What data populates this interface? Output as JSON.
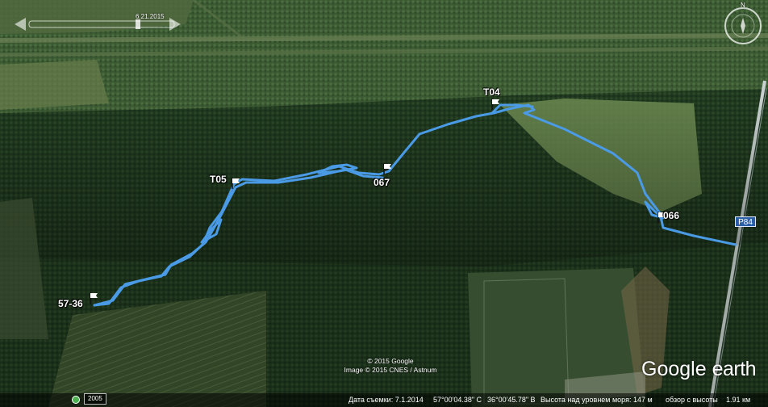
{
  "time_slider": {
    "date": "6.21.2015"
  },
  "compass": {
    "north_label": "N"
  },
  "waypoints": [
    {
      "name": "T04"
    },
    {
      "name": "T05"
    },
    {
      "name": "067"
    },
    {
      "name": "066"
    },
    {
      "name": "57-36"
    }
  ],
  "road": {
    "label": "P84"
  },
  "copyright": {
    "line1": "© 2015 Google",
    "line2": "Image © 2015 CNES / Astnum"
  },
  "logo": {
    "word1": "Google",
    "word2": "earth"
  },
  "status_bar": {
    "year": "2005",
    "imagery_date": "Дата съемки: 7.1.2014",
    "latitude": "57°00'04.38\" С",
    "longitude": "36°00'45.78\" В",
    "elevation": "Высота над уровнем моря:  147 м",
    "eye_alt": "обзор с высоты",
    "eye_alt_value": "1.91 км"
  },
  "colors": {
    "track": "#4a9ae6",
    "forest": "#1e3a1e",
    "field": "#5a7a3a"
  }
}
